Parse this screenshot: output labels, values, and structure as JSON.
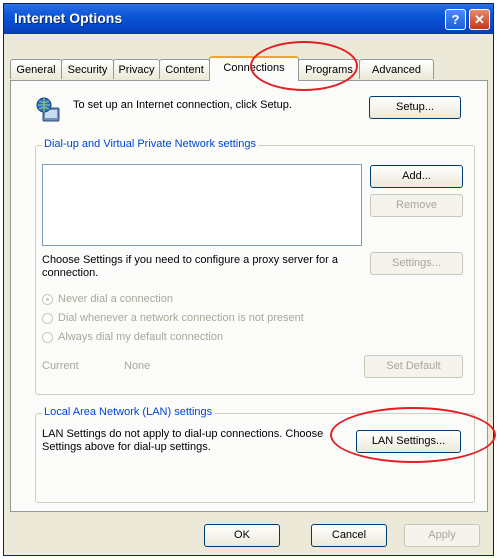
{
  "window": {
    "title": "Internet Options"
  },
  "tabs": [
    {
      "label": "General",
      "active": false
    },
    {
      "label": "Security",
      "active": false
    },
    {
      "label": "Privacy",
      "active": false
    },
    {
      "label": "Content",
      "active": false
    },
    {
      "label": "Connections",
      "active": true
    },
    {
      "label": "Programs",
      "active": false
    },
    {
      "label": "Advanced",
      "active": false
    }
  ],
  "setup": {
    "text": "To set up an Internet connection, click Setup.",
    "button": "Setup..."
  },
  "dialup": {
    "legend": "Dial-up and Virtual Private Network settings",
    "add_button": "Add...",
    "remove_button": "Remove",
    "settings_button": "Settings...",
    "proxy_text": "Choose Settings if you need to configure a proxy server for a connection.",
    "radios": [
      {
        "label": "Never dial a connection",
        "checked": true
      },
      {
        "label": "Dial whenever a network connection is not present",
        "checked": false
      },
      {
        "label": "Always dial my default connection",
        "checked": false
      }
    ],
    "current_label": "Current",
    "current_value": "None",
    "set_default_button": "Set Default"
  },
  "lan": {
    "legend": "Local Area Network (LAN) settings",
    "text": "LAN Settings do not apply to dial-up connections. Choose Settings above for dial-up settings.",
    "button": "LAN Settings..."
  },
  "footer": {
    "ok": "OK",
    "cancel": "Cancel",
    "apply": "Apply"
  },
  "annotations": {
    "color": "#e31e24",
    "highlighted": [
      "Connections",
      "LAN Settings..."
    ]
  }
}
